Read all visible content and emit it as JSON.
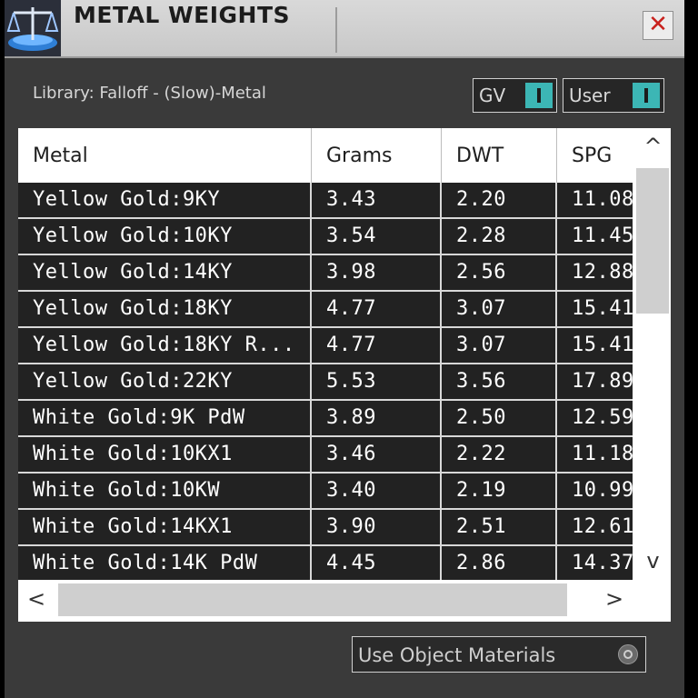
{
  "window": {
    "title": "METAL WEIGHTS",
    "close_label": "✕",
    "logo_icon": "balance-scale-icon"
  },
  "library_label": "Library: Falloff - (Slow)-Metal",
  "toggles": [
    {
      "label": "GV",
      "state": "on"
    },
    {
      "label": "User",
      "state": "on"
    }
  ],
  "table": {
    "columns": [
      "Metal",
      "Grams",
      "DWT",
      "SPG"
    ],
    "rows": [
      [
        "Yellow Gold:9KY",
        "3.43",
        "2.20",
        "11.08"
      ],
      [
        "Yellow Gold:10KY",
        "3.54",
        "2.28",
        "11.45"
      ],
      [
        "Yellow Gold:14KY",
        "3.98",
        "2.56",
        "12.88"
      ],
      [
        "Yellow Gold:18KY",
        "4.77",
        "3.07",
        "15.41"
      ],
      [
        "Yellow Gold:18KY R...",
        "4.77",
        "3.07",
        "15.41"
      ],
      [
        "Yellow Gold:22KY",
        "5.53",
        "3.56",
        "17.89"
      ],
      [
        "White Gold:9K PdW",
        "3.89",
        "2.50",
        "12.59"
      ],
      [
        "White Gold:10KX1",
        "3.46",
        "2.22",
        "11.18"
      ],
      [
        "White Gold:10KW",
        "3.40",
        "2.19",
        "10.99"
      ],
      [
        "White Gold:14KX1",
        "3.90",
        "2.51",
        "12.61"
      ],
      [
        "White Gold:14K PdW",
        "4.45",
        "2.86",
        "14.37"
      ]
    ]
  },
  "scroll": {
    "up": "^",
    "down": "v",
    "left": "<",
    "right": ">"
  },
  "use_object_materials_label": "Use Object Materials",
  "colors": {
    "panel_bg": "#3a3a3a",
    "toggle_accent": "#3cb6b5",
    "close_red": "#c8211d"
  }
}
